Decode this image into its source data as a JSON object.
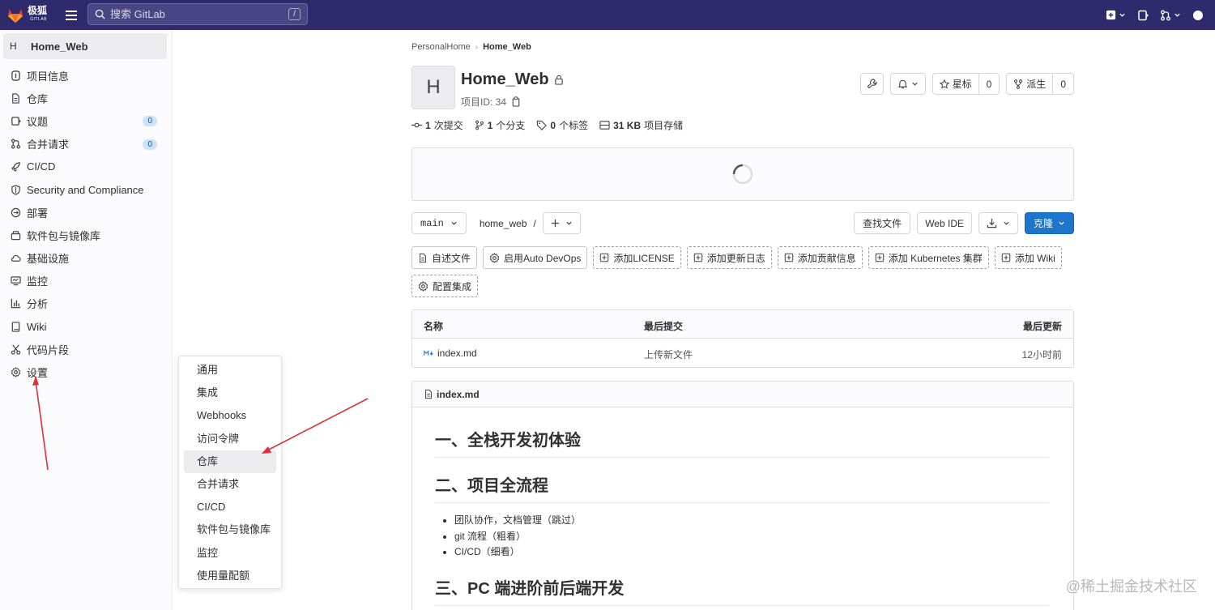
{
  "topbar": {
    "brand": "极狐",
    "brand_sub": "GITLAB",
    "search_placeholder": "搜索 GitLab",
    "search_shortcut": "/"
  },
  "sidebar": {
    "project_letter": "H",
    "project_name": "Home_Web",
    "items": [
      {
        "label": "项目信息",
        "icon": "info-icon"
      },
      {
        "label": "仓库",
        "icon": "file-icon"
      },
      {
        "label": "议题",
        "icon": "issues-icon",
        "badge": "0"
      },
      {
        "label": "合并请求",
        "icon": "merge-request-icon",
        "badge": "0"
      },
      {
        "label": "CI/CD",
        "icon": "rocket-icon"
      },
      {
        "label": "Security and Compliance",
        "icon": "shield-icon"
      },
      {
        "label": "部署",
        "icon": "deploy-icon"
      },
      {
        "label": "软件包与镜像库",
        "icon": "package-icon"
      },
      {
        "label": "基础设施",
        "icon": "cloud-icon"
      },
      {
        "label": "监控",
        "icon": "monitor-icon"
      },
      {
        "label": "分析",
        "icon": "chart-icon"
      },
      {
        "label": "Wiki",
        "icon": "book-icon"
      },
      {
        "label": "代码片段",
        "icon": "scissors-icon"
      },
      {
        "label": "设置",
        "icon": "gear-icon"
      }
    ]
  },
  "flyout": {
    "items": [
      "通用",
      "集成",
      "Webhooks",
      "访问令牌",
      "仓库",
      "合并请求",
      "CI/CD",
      "软件包与镜像库",
      "监控",
      "使用量配额"
    ],
    "active": "仓库"
  },
  "breadcrumb": {
    "parent": "PersonalHome",
    "current": "Home_Web"
  },
  "project": {
    "letter": "H",
    "title": "Home_Web",
    "id_label": "项目ID: 34",
    "star_label": "星标",
    "star_count": "0",
    "fork_label": "派生",
    "fork_count": "0"
  },
  "stats": {
    "commits_num": "1",
    "commits_label": "次提交",
    "branches_num": "1",
    "branches_label": "个分支",
    "tags_num": "0",
    "tags_label": "个标签",
    "storage_num": "31 KB",
    "storage_label": "项目存储"
  },
  "repo_bar": {
    "branch": "main",
    "path": "home_web",
    "path_sep": "/",
    "find_file": "查找文件",
    "web_ide": "Web IDE",
    "clone": "克隆"
  },
  "shortcuts": [
    {
      "label": "自述文件",
      "icon": "file-icon",
      "style": "solid"
    },
    {
      "label": "启用Auto DevOps",
      "icon": "gear-icon",
      "style": "solid"
    },
    {
      "label": "添加LICENSE",
      "icon": "plus-square-icon",
      "style": "dashed"
    },
    {
      "label": "添加更新日志",
      "icon": "plus-square-icon",
      "style": "dashed"
    },
    {
      "label": "添加贡献信息",
      "icon": "plus-square-icon",
      "style": "dashed"
    },
    {
      "label": "添加 Kubernetes 集群",
      "icon": "plus-square-icon",
      "style": "dashed"
    },
    {
      "label": "添加 Wiki",
      "icon": "plus-square-icon",
      "style": "dashed"
    },
    {
      "label": "配置集成",
      "icon": "gear-icon",
      "style": "dashed"
    }
  ],
  "file_table": {
    "headers": [
      "名称",
      "最后提交",
      "最后更新"
    ],
    "rows": [
      {
        "name": "index.md",
        "commit": "上传新文件",
        "updated": "12小时前"
      }
    ]
  },
  "readme": {
    "filename": "index.md",
    "h1": "一、全栈开发初体验",
    "h2": "二、项目全流程",
    "list": [
      "团队协作，文档管理（跳过）",
      "git 流程（粗看）",
      "CI/CD（细看）"
    ],
    "h3": "三、PC 端进阶前后端开发"
  },
  "watermark": "@稀土掘金技术社区",
  "colors": {
    "topbar": "#2f2a6b",
    "primary": "#1f75cb",
    "annotation_arrow": "#e0303a"
  }
}
